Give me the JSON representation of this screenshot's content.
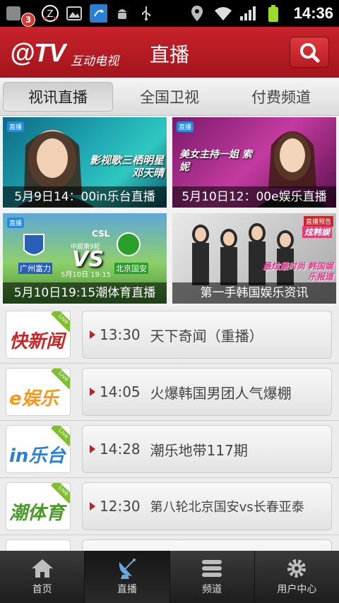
{
  "statusbar": {
    "notification_count": "3",
    "time": "14:36"
  },
  "header": {
    "logo": "@TV",
    "logo_subtitle": "互动电视",
    "title": "直播"
  },
  "tabs": [
    {
      "label": "视讯直播",
      "active": true
    },
    {
      "label": "全国卫视",
      "active": false
    },
    {
      "label": "付费频道",
      "active": false
    }
  ],
  "banners": [
    {
      "caption": "5月9日14：00in乐台直播",
      "overlay": "影视歌三栖明星 邓天晴"
    },
    {
      "caption": "5月10日12：00e娱乐直播",
      "overlay": "美女主持一姐 索妮"
    },
    {
      "caption": "5月10日19:15潮体育直播",
      "overlay": "VS",
      "match_info": "中超第9轮",
      "team_left": "广州富力",
      "team_right": "北京国安",
      "match_time": "5月10日 19:15",
      "league": "CSL"
    },
    {
      "caption": "第一手韩国娱乐资讯",
      "overlay": "最炫最时尚 韩国娱乐报道",
      "corner_tag": "直播预告",
      "corner_brand": "炫韩娱"
    }
  ],
  "programs": [
    {
      "channel": "快新闻",
      "time": "13:30",
      "title": "天下奇闻（重播）",
      "color": "#c62828"
    },
    {
      "channel": "e娱乐",
      "time": "14:05",
      "title": "火爆韩国男团人气爆棚",
      "color": "#f39a1e"
    },
    {
      "channel": "in乐台",
      "time": "14:28",
      "title": "潮乐地带117期",
      "color": "#2d7fd1"
    },
    {
      "channel": "潮体育",
      "time": "12:30",
      "title": "第八轮北京国安vs长春亚泰",
      "color": "#4a9a2a"
    }
  ],
  "bottom_nav": [
    {
      "label": "首页",
      "icon": "home-icon",
      "active": false
    },
    {
      "label": "直播",
      "icon": "satellite-dish-icon",
      "active": true
    },
    {
      "label": "频道",
      "icon": "list-icon",
      "active": false
    },
    {
      "label": "用户中心",
      "icon": "gear-icon",
      "active": false
    }
  ],
  "colors": {
    "brand_red": "#c1232b",
    "tab_bg": "#e8e8e8",
    "bottom_bar": "#2a2a2a"
  }
}
